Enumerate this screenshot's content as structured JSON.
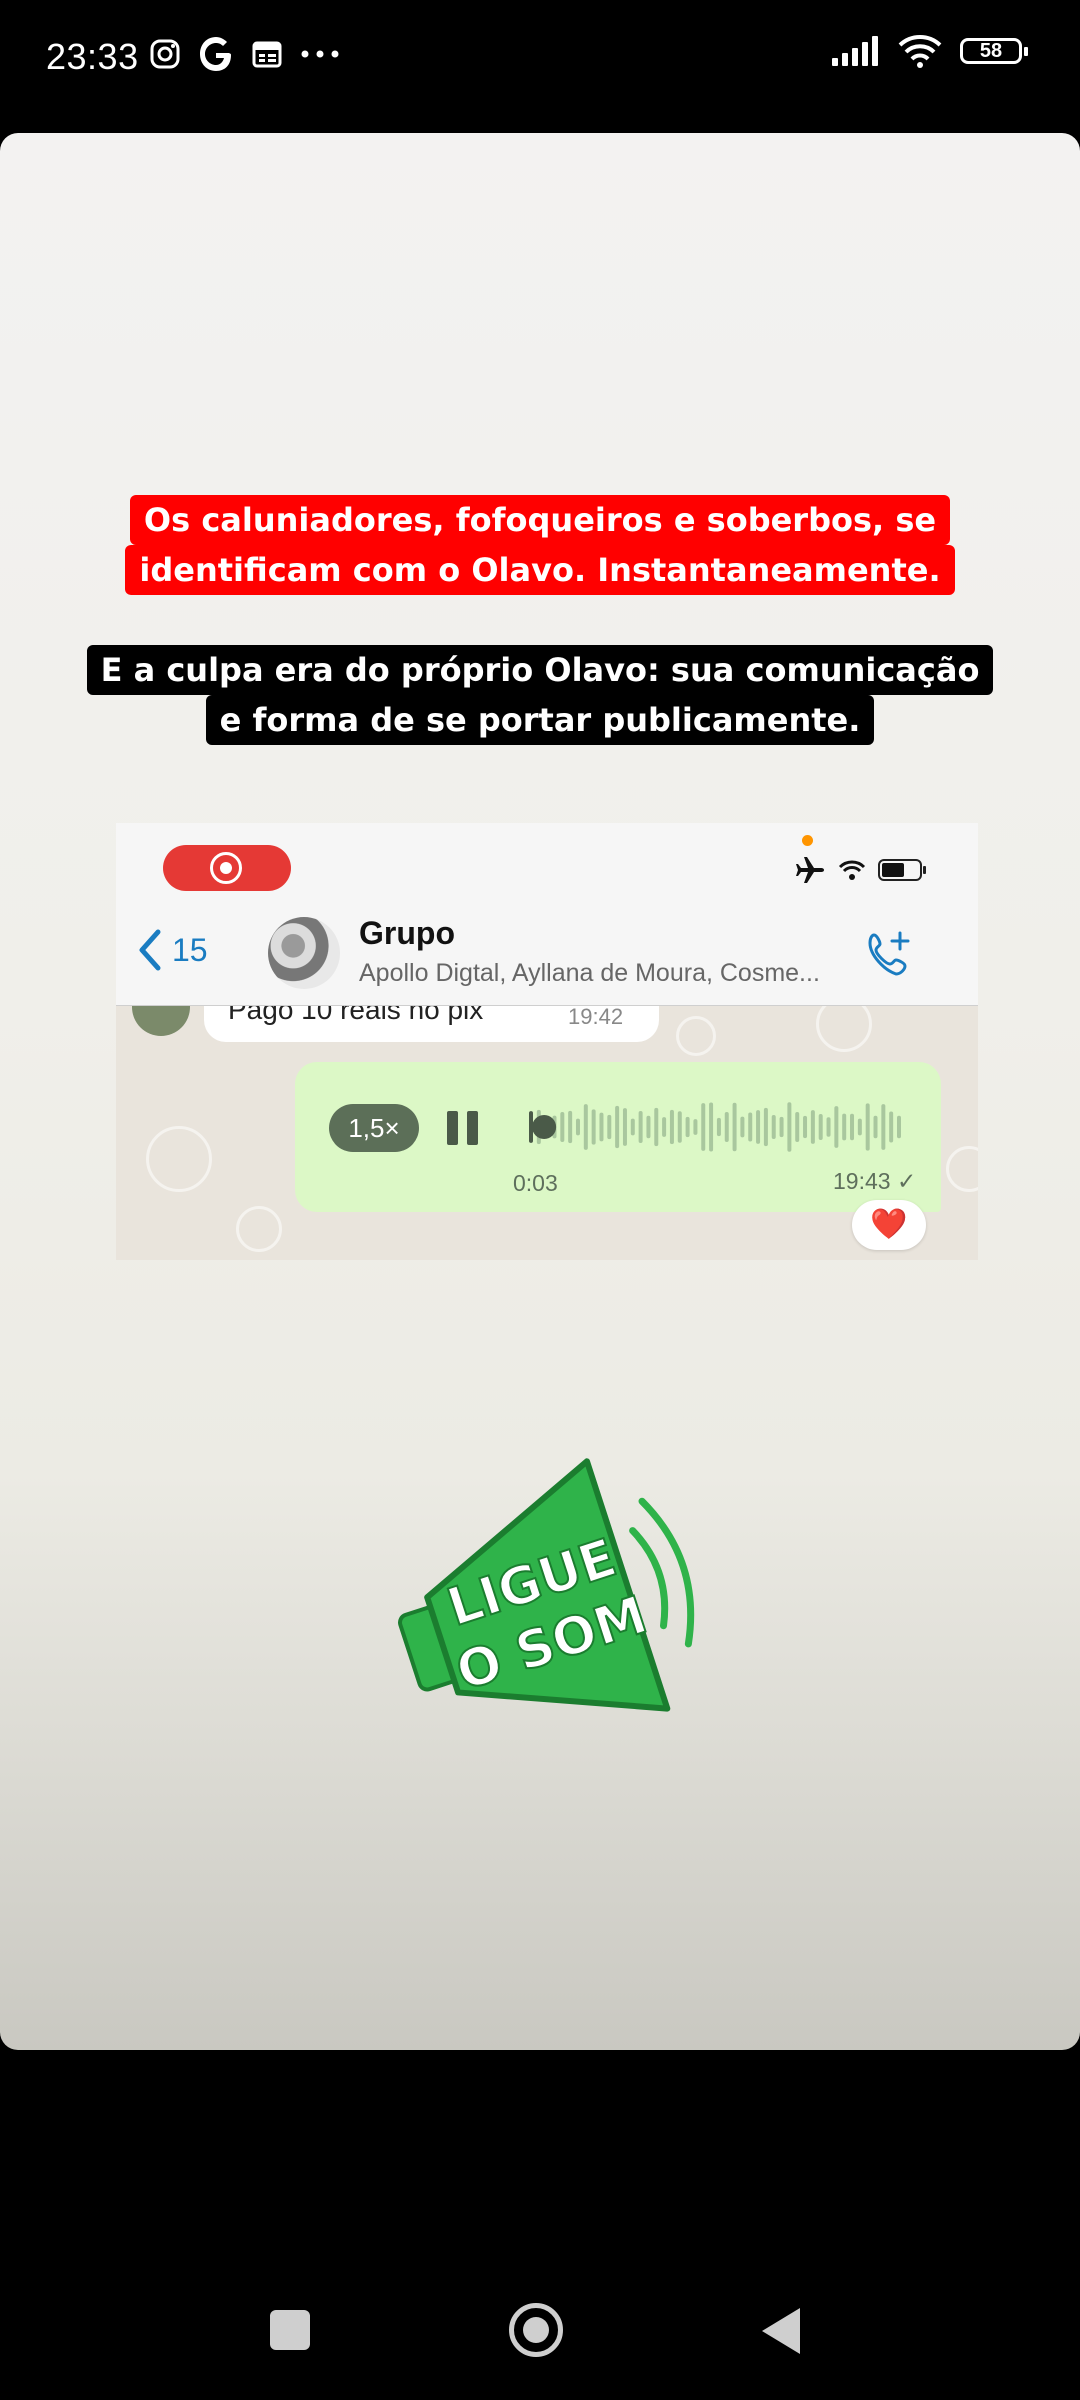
{
  "status_bar": {
    "time": "23:33",
    "battery": "58",
    "left_icons": [
      "instagram-icon",
      "google-icon",
      "calendar-icon",
      "more-dots-icon"
    ],
    "right_icons": [
      "signal-icon",
      "wifi-icon",
      "battery-icon"
    ]
  },
  "story": {
    "caption_red": [
      "Os caluniadores, fofoqueiros e soberbos, se",
      "identificam com o Olavo. Instantaneamente."
    ],
    "caption_black": [
      "E a culpa era do próprio Olavo: sua comunicação",
      "e forma de se portar publicamente."
    ],
    "sticker": "LIGUE O SOM"
  },
  "whatsapp": {
    "back_count": "15",
    "group_name": "Grupo",
    "members": "Apollo Digtal, Ayllana de Moura, Cosme...",
    "prev_message": "Pago 10 reais no pix",
    "prev_time": "19:42",
    "voice": {
      "speed": "1,5×",
      "duration": "0:03",
      "time": "19:43",
      "check": "✓",
      "progress": 0.02
    },
    "reaction": "❤️"
  },
  "colors": {
    "caption_red_bg": "#ff0000",
    "whatsapp_bubble": "#dcf8c6",
    "ios_link": "#1a7cc1",
    "sticker_green": "#2fb34a"
  }
}
